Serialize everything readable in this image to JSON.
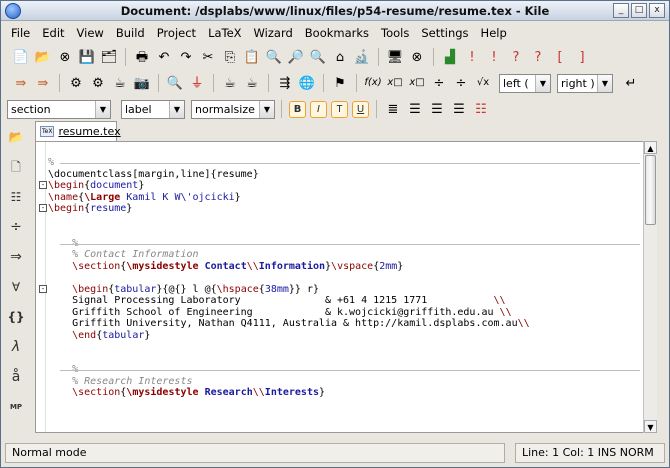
{
  "window": {
    "title": "Document: /dsplabs/www/linux/files/p54-resume/resume.tex - Kile",
    "controls": {
      "minimize": "_",
      "maximize": "□",
      "close": "x"
    }
  },
  "menubar": [
    "File",
    "Edit",
    "View",
    "Build",
    "Project",
    "LaTeX",
    "Wizard",
    "Bookmarks",
    "Tools",
    "Settings",
    "Help"
  ],
  "toolbar2": {
    "math_labels": [
      "f(x)",
      "x□",
      "x□",
      "÷",
      "÷",
      "√x"
    ],
    "left_combo": "left (",
    "right_combo": "right )"
  },
  "toolbar3": {
    "section_combo": "section",
    "label_combo": "label",
    "size_combo": "normalsize",
    "format_buttons": [
      "B",
      "I",
      "T",
      "U"
    ]
  },
  "sidebar": [
    "open-icon",
    "document-icon",
    "structure-icon",
    "plus-icon",
    "arrow-icon",
    "forall-icon",
    "braces-icon",
    "lambda-icon",
    "a-ring-icon",
    "MP"
  ],
  "tab": {
    "label": "resume.tex",
    "icon_text": "TeX"
  },
  "editor": {
    "lines": [
      {
        "t": "%",
        "c": "cmt",
        "rule": true
      },
      {
        "t": "\\documentclass[margin,line]{resume}"
      },
      {
        "t": "\\begin{document}",
        "fold": "-"
      },
      {
        "t": "\\name{\\Large Kamil K W\\'ojcicki}"
      },
      {
        "t": "\\begin{resume}",
        "fold": "-"
      },
      {
        "t": ""
      },
      {
        "t": ""
      },
      {
        "t": "    %",
        "c": "cmt",
        "rule": true
      },
      {
        "t": "    % Contact Information",
        "c": "cmt"
      },
      {
        "t": "    \\section{\\mysidestyle Contact\\\\Information}\\vspace{2mm}"
      },
      {
        "t": ""
      },
      {
        "t": "    \\begin{tabular}{@{} l @{\\hspace{38mm}} r}",
        "fold": "-"
      },
      {
        "t": "    Signal Processing Laboratory              & +61 4 1215 1771           \\\\"
      },
      {
        "t": "    Griffith School of Engineering            & k.wojcicki@griffith.edu.au \\\\"
      },
      {
        "t": "    Griffith University, Nathan Q4111, Australia & http://kamil.dsplabs.com.au\\\\"
      },
      {
        "t": "    \\end{tabular}"
      },
      {
        "t": ""
      },
      {
        "t": ""
      },
      {
        "t": "    %",
        "c": "cmt",
        "rule": true
      },
      {
        "t": "    % Research Interests",
        "c": "cmt"
      },
      {
        "t": "    \\section{\\mysidestyle Research\\\\Interests}"
      }
    ]
  },
  "status": {
    "mode": "Normal mode",
    "position": "Line: 1 Col: 1  INS  NORM"
  }
}
